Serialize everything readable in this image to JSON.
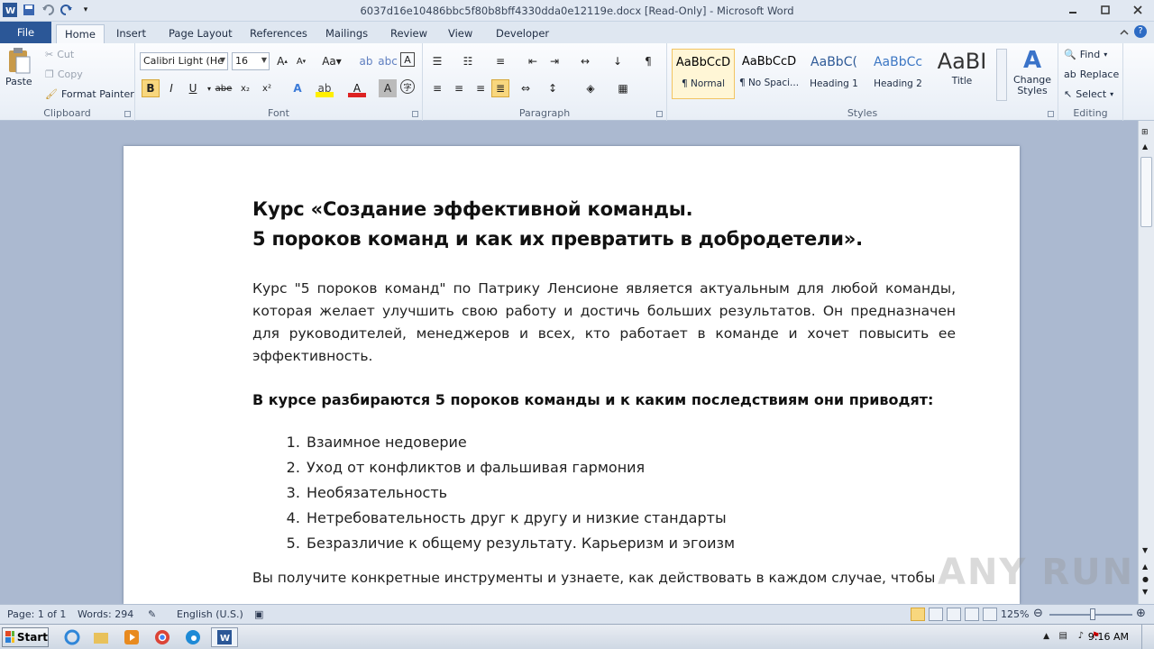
{
  "window": {
    "title": "6037d16e10486bbc5f80b8bff4330dda0e12119e.docx [Read-Only] - Microsoft Word"
  },
  "tabs": [
    "File",
    "Home",
    "Insert",
    "Page Layout",
    "References",
    "Mailings",
    "Review",
    "View",
    "Developer"
  ],
  "active_tab": "Home",
  "ribbon": {
    "clipboard": {
      "label": "Clipboard",
      "paste": "Paste",
      "cut": "Cut",
      "copy": "Copy",
      "format_painter": "Format Painter"
    },
    "font": {
      "label": "Font",
      "font_name": "Calibri Light (He",
      "font_size": "16"
    },
    "paragraph": {
      "label": "Paragraph"
    },
    "styles": {
      "label": "Styles",
      "items": [
        {
          "preview": "AaBbCcD",
          "name": "¶ Normal"
        },
        {
          "preview": "AaBbCcD",
          "name": "¶ No Spaci..."
        },
        {
          "preview": "AaBbC(",
          "name": "Heading 1"
        },
        {
          "preview": "AaBbCc",
          "name": "Heading 2"
        },
        {
          "preview": "AaBI",
          "name": "Title"
        }
      ],
      "change_styles": "Change Styles"
    },
    "editing": {
      "label": "Editing",
      "find": "Find",
      "replace": "Replace",
      "select": "Select"
    }
  },
  "document": {
    "title_line1": "Курс «Создание эффективной команды.",
    "title_line2": "5 пороков команд и как их превратить в добродетели».",
    "intro": "Курс \"5 пороков команд\" по Патрику Ленсионе является актуальным для любой команды, которая желает улучшить свою работу и достичь больших результатов. Он предназначен для руководителей, менеджеров и всех, кто работает в команде и хочет повысить ее эффективность.",
    "lead": "В курсе разбираются 5 пороков команды и к каким последствиям они приводят:",
    "list": [
      "Взаимное недоверие",
      "Уход от конфликтов и фальшивая гармония",
      "Необязательность",
      "Нетребовательность друг к другу и низкие стандарты",
      "Безразличие к общему результату. Карьеризм и эгоизм"
    ],
    "next_para": "Вы получите конкретные инструменты и узнаете, как действовать в каждом случае, чтобы"
  },
  "status": {
    "page": "Page: 1 of 1",
    "words": "Words: 294",
    "language": "English (U.S.)",
    "zoom": "125%"
  },
  "taskbar": {
    "start": "Start",
    "time": "9:16 AM"
  },
  "watermark": "ANY RUN",
  "colors": {
    "file_tab": "#2b5797",
    "ribbon_bg": "#e8eef6",
    "workspace": "#abb9d0"
  }
}
